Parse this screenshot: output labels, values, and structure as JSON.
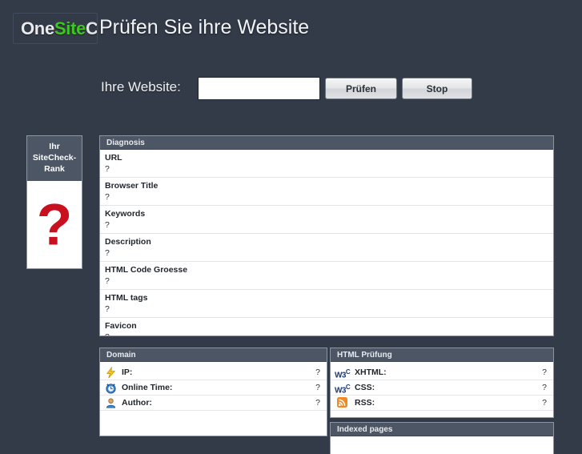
{
  "header": {
    "logo": {
      "part1": "One",
      "part2": "Site",
      "part3": "Ch"
    },
    "title": "Prüfen Sie ihre Website"
  },
  "form": {
    "label": "Ihre Website:",
    "input_value": "",
    "input_placeholder": "",
    "check_button": "Prüfen",
    "stop_button": "Stop"
  },
  "rank_card": {
    "title": "Ihr SiteCheck-Rank",
    "value": "?",
    "color": "#c9101f"
  },
  "diagnosis": {
    "title": "Diagnosis",
    "rows": [
      {
        "label": "URL",
        "value": "?"
      },
      {
        "label": "Browser Title",
        "value": "?"
      },
      {
        "label": "Keywords",
        "value": "?"
      },
      {
        "label": "Description",
        "value": "?"
      },
      {
        "label": "HTML Code Groesse",
        "value": "?"
      },
      {
        "label": "HTML tags",
        "value": "?"
      },
      {
        "label": "Favicon",
        "value": "?"
      }
    ]
  },
  "domain": {
    "title": "Domain",
    "rows": [
      {
        "icon": "lightning-icon",
        "label": "IP:",
        "value": "?"
      },
      {
        "icon": "alarm-clock-icon",
        "label": "Online Time:",
        "value": "?"
      },
      {
        "icon": "user-icon",
        "label": "Author:",
        "value": "?"
      }
    ]
  },
  "html_check": {
    "title": "HTML Prüfung",
    "rows": [
      {
        "icon": "w3c-icon",
        "label": "XHTML:",
        "value": "?"
      },
      {
        "icon": "w3c-icon",
        "label": "CSS:",
        "value": "?"
      },
      {
        "icon": "rss-icon",
        "label": "RSS:",
        "value": "?"
      }
    ]
  },
  "indexed": {
    "title": "Indexed pages"
  },
  "theme": {
    "background": "#333b49",
    "panel_header": "#4d5665",
    "accent_green": "#3ec71c",
    "accent_red": "#c9101f"
  }
}
